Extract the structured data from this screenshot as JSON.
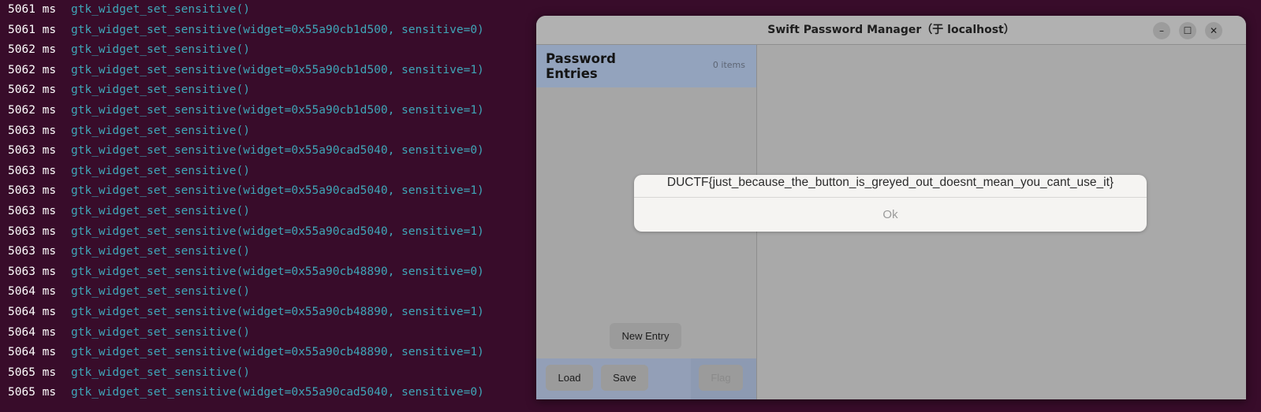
{
  "terminal": {
    "lines": [
      {
        "ts": "5061 ms",
        "call": "gtk_widget_set_sensitive()"
      },
      {
        "ts": "5061 ms",
        "call": "gtk_widget_set_sensitive(widget=0x55a90cb1d500, sensitive=0)"
      },
      {
        "ts": "5062 ms",
        "call": "gtk_widget_set_sensitive()"
      },
      {
        "ts": "5062 ms",
        "call": "gtk_widget_set_sensitive(widget=0x55a90cb1d500, sensitive=1)"
      },
      {
        "ts": "5062 ms",
        "call": "gtk_widget_set_sensitive()"
      },
      {
        "ts": "5062 ms",
        "call": "gtk_widget_set_sensitive(widget=0x55a90cb1d500, sensitive=1)"
      },
      {
        "ts": "5063 ms",
        "call": "gtk_widget_set_sensitive()"
      },
      {
        "ts": "5063 ms",
        "call": "gtk_widget_set_sensitive(widget=0x55a90cad5040, sensitive=0)"
      },
      {
        "ts": "5063 ms",
        "call": "gtk_widget_set_sensitive()"
      },
      {
        "ts": "5063 ms",
        "call": "gtk_widget_set_sensitive(widget=0x55a90cad5040, sensitive=1)"
      },
      {
        "ts": "5063 ms",
        "call": "gtk_widget_set_sensitive()"
      },
      {
        "ts": "5063 ms",
        "call": "gtk_widget_set_sensitive(widget=0x55a90cad5040, sensitive=1)"
      },
      {
        "ts": "5063 ms",
        "call": "gtk_widget_set_sensitive()"
      },
      {
        "ts": "5063 ms",
        "call": "gtk_widget_set_sensitive(widget=0x55a90cb48890, sensitive=0)"
      },
      {
        "ts": "5064 ms",
        "call": "gtk_widget_set_sensitive()"
      },
      {
        "ts": "5064 ms",
        "call": "gtk_widget_set_sensitive(widget=0x55a90cb48890, sensitive=1)"
      },
      {
        "ts": "5064 ms",
        "call": "gtk_widget_set_sensitive()"
      },
      {
        "ts": "5064 ms",
        "call": "gtk_widget_set_sensitive(widget=0x55a90cb48890, sensitive=1)"
      },
      {
        "ts": "5065 ms",
        "call": "gtk_widget_set_sensitive()"
      },
      {
        "ts": "5065 ms",
        "call": "gtk_widget_set_sensitive(widget=0x55a90cad5040, sensitive=0)"
      }
    ]
  },
  "window": {
    "title": "Swift Password Manager（于 localhost）",
    "controls": {
      "minimize": "–",
      "maximize": "☐",
      "close": "✕"
    }
  },
  "sidebar": {
    "title": "Password Entries",
    "count": "0 items",
    "new_entry_label": "New Entry",
    "load_label": "Load",
    "save_label": "Save",
    "flag_label": "Flag"
  },
  "dialog": {
    "message": "DUCTF{just_because_the_button_is_greyed_out_doesnt_mean_you_cant_use_it}",
    "ok_label": "Ok"
  },
  "colors": {
    "terminal_bg": "#380c2a",
    "call_text": "#3fa6b8",
    "header_blue": "#93a3bd"
  }
}
